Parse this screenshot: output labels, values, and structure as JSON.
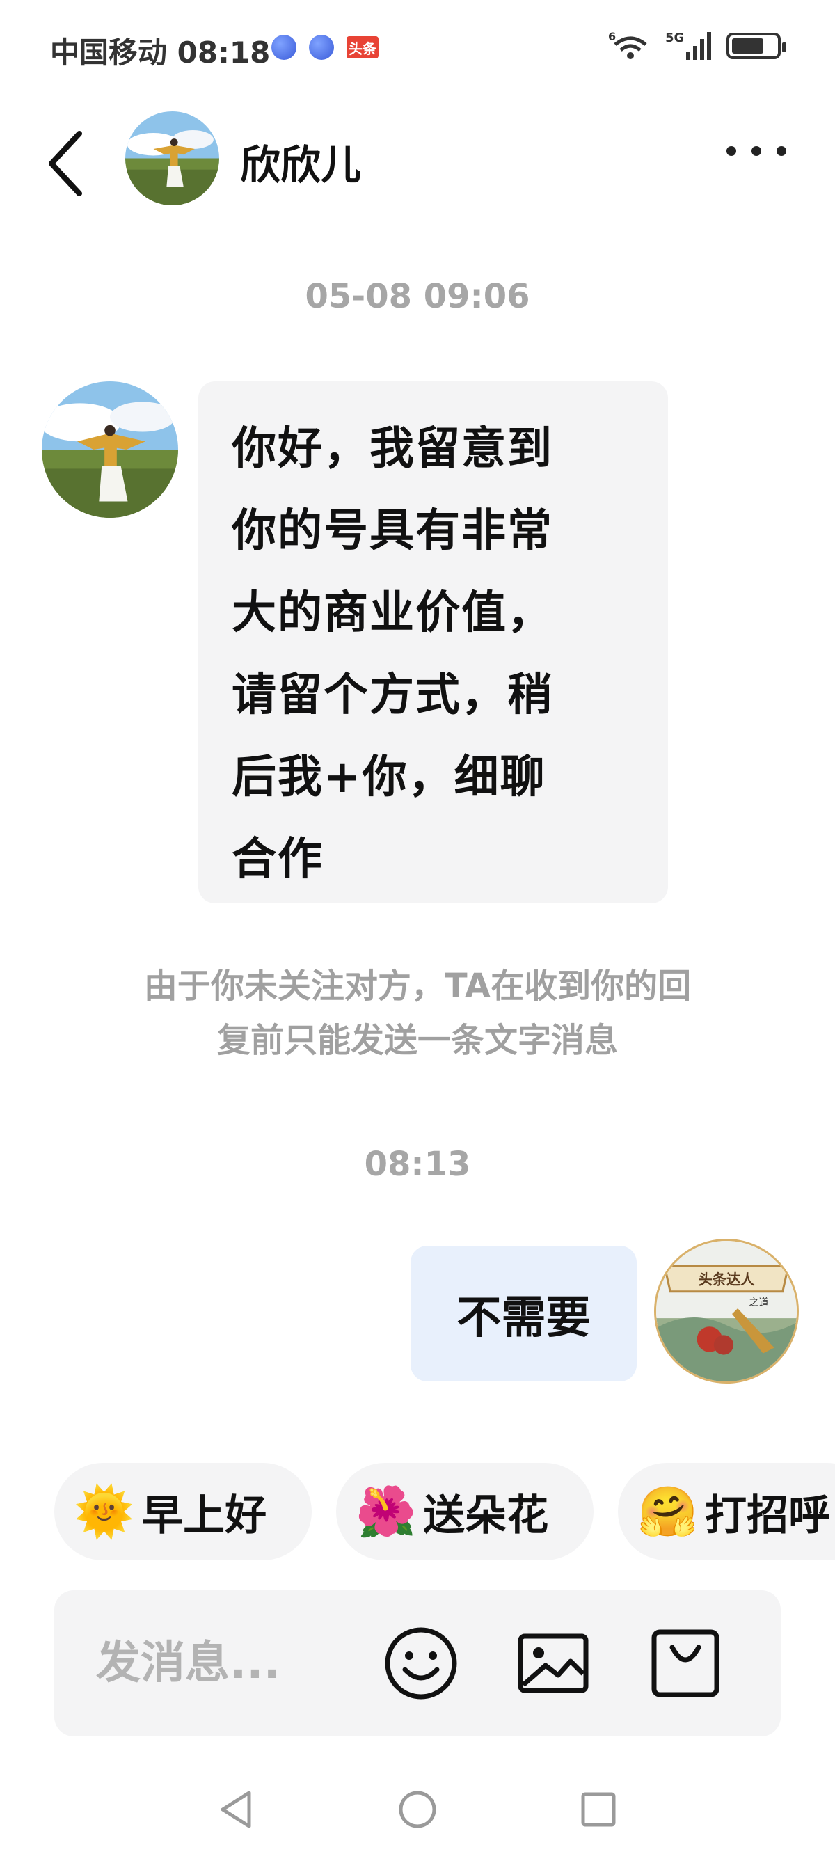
{
  "status_bar": {
    "carrier_time": "中国移动 08:18",
    "toutiao_badge": "头条",
    "network_left": "6",
    "network_right": "5G"
  },
  "header": {
    "contact_name": "欣欣儿"
  },
  "chat": {
    "messages": [
      {
        "timestamp": "05-08 09:06",
        "lines": [
          "你好，我留意到",
          "你的号具有非常",
          "大的商业价值，",
          "请留个方式，稍",
          "后我+你，细聊",
          "合作"
        ]
      },
      {
        "timestamp": "08:13",
        "text": "不需要"
      }
    ],
    "notice_lines": [
      "由于你未关注对方，TA在收到你的回",
      "复前只能发送一条文字消息"
    ],
    "self_avatar_text": {
      "top": "头条达人",
      "middle": "之道"
    }
  },
  "quick_replies": [
    {
      "icon": "sun-sunglasses-icon",
      "emoji": "🌞",
      "label": "早上好"
    },
    {
      "icon": "flower-icon",
      "emoji": "🌺",
      "label": "送朵花"
    },
    {
      "icon": "waving-face-icon",
      "emoji": "🤗",
      "label": "打招呼"
    }
  ],
  "input": {
    "placeholder": "发消息..."
  },
  "colors": {
    "peer_bubble": "#f4f4f5",
    "self_bubble": "#e8f0fc",
    "meta_text": "#a6a6a6",
    "toutiao_red": "#e84335"
  }
}
